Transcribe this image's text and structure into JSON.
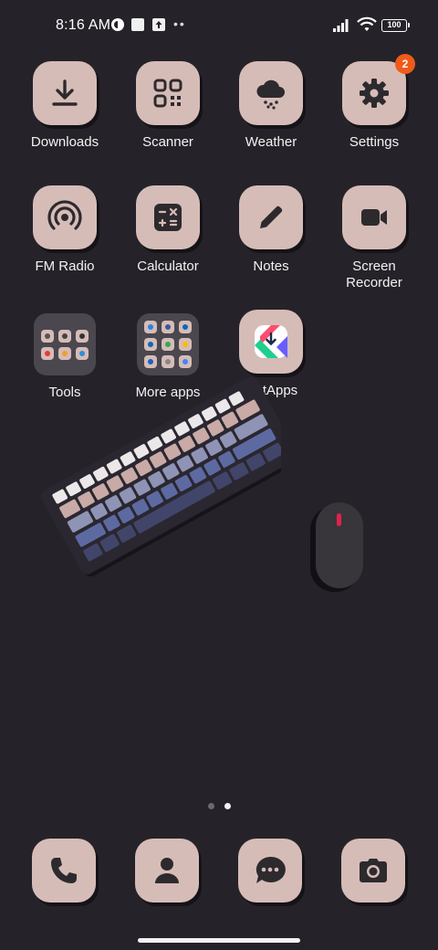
{
  "status_bar": {
    "time": "8:16 AM",
    "battery": "100",
    "icons": [
      "notification-c-icon",
      "square-notification-icon",
      "upload-notification-icon",
      "more-dots-icon",
      "signal-icon",
      "wifi-icon",
      "battery-icon"
    ]
  },
  "apps": [
    {
      "label": "Downloads",
      "icon": "download-icon"
    },
    {
      "label": "Scanner",
      "icon": "scanner-icon"
    },
    {
      "label": "Weather",
      "icon": "weather-icon"
    },
    {
      "label": "Settings",
      "icon": "gear-icon",
      "badge": "2"
    },
    {
      "label": "FM Radio",
      "icon": "radio-icon"
    },
    {
      "label": "Calculator",
      "icon": "calculator-icon"
    },
    {
      "label": "Notes",
      "icon": "pencil-icon"
    },
    {
      "label": "Screen Recorder",
      "icon": "video-camera-icon"
    }
  ],
  "folders": [
    {
      "label": "Tools"
    },
    {
      "label": "More apps"
    }
  ],
  "getapps": {
    "label": "GetApps",
    "icon": "getapps-icon"
  },
  "pager": {
    "pages": 2,
    "current": 2
  },
  "dock": [
    {
      "icon": "phone-icon"
    },
    {
      "icon": "contacts-icon"
    },
    {
      "icon": "messages-icon"
    },
    {
      "icon": "camera-icon"
    }
  ],
  "colors": {
    "background": "#252329",
    "tile": "#d6bcb7",
    "glyph": "#2d2a2e",
    "badge": "#f05a1a"
  }
}
